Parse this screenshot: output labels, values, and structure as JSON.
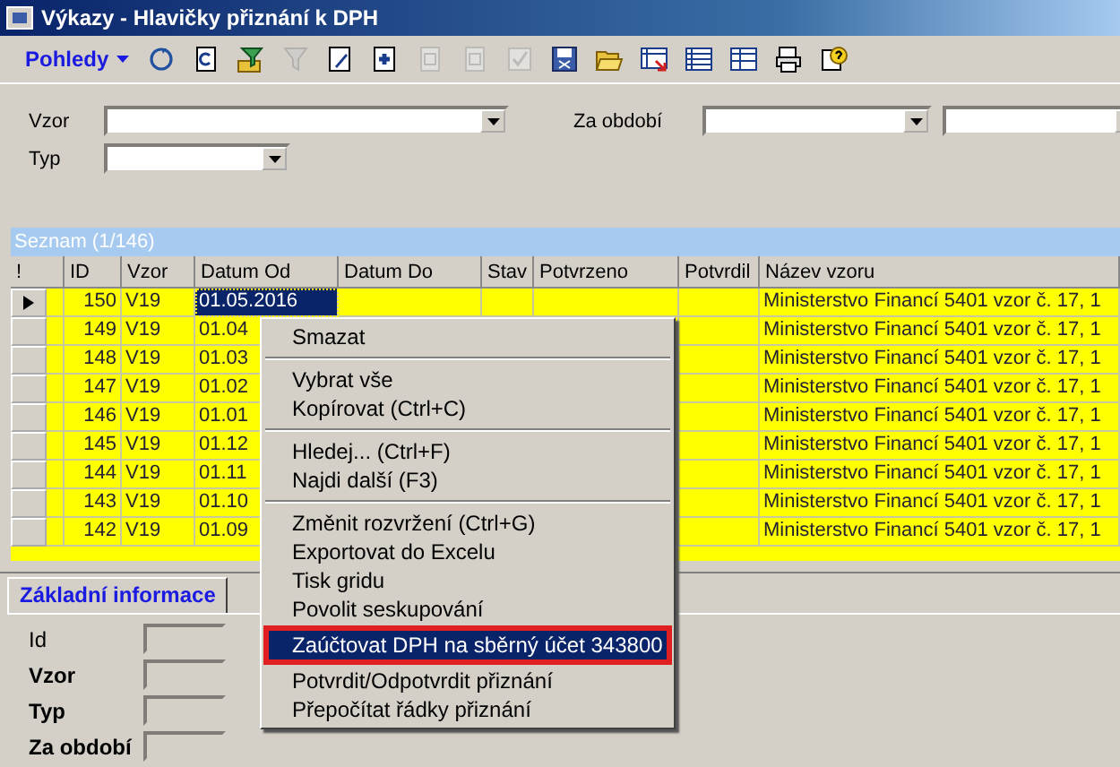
{
  "window": {
    "title": "Výkazy - Hlavičky přiznání k DPH"
  },
  "toolbar": {
    "views_label": "Pohledy",
    "tools": [
      {
        "kind": "refresh",
        "disabled": false
      },
      {
        "kind": "copy",
        "disabled": false
      },
      {
        "kind": "filter",
        "disabled": false
      },
      {
        "kind": "funnel",
        "disabled": true
      },
      {
        "kind": "edit",
        "disabled": false
      },
      {
        "kind": "add",
        "disabled": false
      },
      {
        "kind": "page",
        "disabled": true
      },
      {
        "kind": "page",
        "disabled": true
      },
      {
        "kind": "check",
        "disabled": true
      },
      {
        "kind": "save",
        "disabled": false
      },
      {
        "kind": "folder",
        "disabled": false
      },
      {
        "kind": "grid",
        "disabled": false
      },
      {
        "kind": "list",
        "disabled": false
      },
      {
        "kind": "table",
        "disabled": false
      },
      {
        "kind": "print",
        "disabled": false
      },
      {
        "kind": "help",
        "disabled": false
      }
    ]
  },
  "filters": [
    {
      "label": "Vzor",
      "kind": "wide"
    },
    {
      "label": "Za období",
      "kind": "pair"
    },
    {
      "label": "Typ",
      "kind": "short"
    }
  ],
  "list": {
    "title": "Seznam (1/146)",
    "columns": [
      "!",
      "ID",
      "Vzor",
      "Datum Od",
      "Datum Do",
      "Stav",
      "Potvrzeno",
      "Potvrdil",
      "Název vzoru"
    ],
    "rows": [
      {
        "selected": true,
        "id": "150",
        "vzor": "V19",
        "datum_od": "01.05.2016",
        "nazev": "Ministerstvo Financí 5401 vzor č. 17, 1"
      },
      {
        "selected": false,
        "id": "149",
        "vzor": "V19",
        "datum_od": "01.04",
        "nazev": "Ministerstvo Financí 5401 vzor č. 17, 1"
      },
      {
        "selected": false,
        "id": "148",
        "vzor": "V19",
        "datum_od": "01.03",
        "nazev": "Ministerstvo Financí 5401 vzor č. 17, 1"
      },
      {
        "selected": false,
        "id": "147",
        "vzor": "V19",
        "datum_od": "01.02",
        "nazev": "Ministerstvo Financí 5401 vzor č. 17, 1"
      },
      {
        "selected": false,
        "id": "146",
        "vzor": "V19",
        "datum_od": "01.01",
        "nazev": "Ministerstvo Financí 5401 vzor č. 17, 1"
      },
      {
        "selected": false,
        "id": "145",
        "vzor": "V19",
        "datum_od": "01.12",
        "nazev": "Ministerstvo Financí 5401 vzor č. 17, 1"
      },
      {
        "selected": false,
        "id": "144",
        "vzor": "V19",
        "datum_od": "01.11",
        "nazev": "Ministerstvo Financí 5401 vzor č. 17, 1"
      },
      {
        "selected": false,
        "id": "143",
        "vzor": "V19",
        "datum_od": "01.10",
        "nazev": "Ministerstvo Financí 5401 vzor č. 17, 1"
      },
      {
        "selected": false,
        "id": "142",
        "vzor": "V19",
        "datum_od": "01.09",
        "nazev": "Ministerstvo Financí 5401 vzor č. 17, 1"
      }
    ]
  },
  "detail": {
    "tab": "Základní informace",
    "fields": [
      {
        "label": "Id",
        "bold": false
      },
      {
        "label": "Vzor",
        "bold": true
      },
      {
        "label": "Typ",
        "bold": true
      },
      {
        "label": "Za období",
        "bold": true
      }
    ]
  },
  "context_menu": {
    "groups": [
      [
        {
          "label": "Smazat",
          "selected": false
        }
      ],
      [
        {
          "label": "Vybrat vše",
          "selected": false
        },
        {
          "label": "Kopírovat (Ctrl+C)",
          "selected": false
        }
      ],
      [
        {
          "label": "Hledej... (Ctrl+F)",
          "selected": false
        },
        {
          "label": "Najdi další (F3)",
          "selected": false
        }
      ],
      [
        {
          "label": "Změnit rozvržení (Ctrl+G)",
          "selected": false
        },
        {
          "label": "Exportovat do Excelu",
          "selected": false
        },
        {
          "label": "Tisk gridu",
          "selected": false
        },
        {
          "label": "Povolit seskupování",
          "selected": false
        }
      ],
      [
        {
          "label": "Zaúčtovat DPH na sběrný účet 343800",
          "selected": true
        }
      ],
      [
        {
          "label": "Potvrdit/Odpotvrdit přiznání",
          "selected": false
        },
        {
          "label": "Přepočítat řádky přiznání",
          "selected": false
        }
      ]
    ]
  }
}
